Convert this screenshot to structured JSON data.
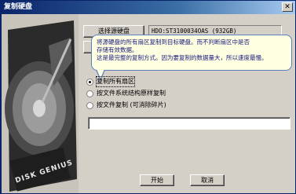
{
  "window": {
    "title": "复制硬盘",
    "close_glyph": "✕"
  },
  "source": {
    "select_button_label": "选择源硬盘",
    "disk_info": "HDO:ST3100034OAS (932GB)"
  },
  "tooltip": {
    "line1": "将源硬盘的所有扇区复制到目标硬盘。而不判断扇区中是否",
    "line2": "存储有效数据。",
    "line3": "这是最完整的复制方式。因为要复制的数据量大，所以速度最慢。"
  },
  "copy_mode": {
    "options": [
      {
        "label": "复制所有扇区",
        "checked": true
      },
      {
        "label": "按文件系统结构原样复制",
        "checked": false
      },
      {
        "label": "按文件复制 (可消除碎片)",
        "checked": false
      }
    ]
  },
  "path_input": {
    "value": ""
  },
  "buttons": {
    "start": "开始",
    "cancel": "取消"
  },
  "decor": {
    "disk_brand": "DISK GENIUS"
  },
  "colors": {
    "titlebar": "#0a246a",
    "face": "#d4d0c8",
    "tooltip_bg": "#ffffe1"
  }
}
